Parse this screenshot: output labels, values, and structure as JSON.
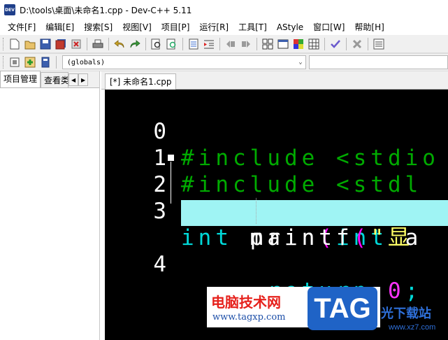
{
  "window": {
    "title": "D:\\tools\\桌面\\未命名1.cpp - Dev-C++ 5.11",
    "app_icon_text": "DEV"
  },
  "menu": [
    "文件[F]",
    "编辑[E]",
    "搜索[S]",
    "视图[V]",
    "项目[P]",
    "运行[R]",
    "工具[T]",
    "AStyle",
    "窗口[W]",
    "帮助[H]"
  ],
  "toolbar2": {
    "scope_combo": "(globals)"
  },
  "left_panel": {
    "tabs": [
      "项目管理",
      "查看类"
    ]
  },
  "editor": {
    "file_tab": "[*] 未命名1.cpp",
    "lines": [
      {
        "num": "0",
        "tokens": [
          {
            "t": "#include <stdio",
            "c": "pre"
          }
        ]
      },
      {
        "num": "1",
        "tokens": [
          {
            "t": "#include <stdl",
            "c": "pre"
          }
        ]
      },
      {
        "num": "2",
        "tokens": [
          {
            "t": "int",
            "c": "kw"
          },
          {
            "t": " main",
            "c": "id"
          },
          {
            "t": "(",
            "c": "paren"
          },
          {
            "t": "int",
            "c": "kw"
          },
          {
            "t": " a",
            "c": "id"
          }
        ]
      },
      {
        "num": "3",
        "tokens": [
          {
            "t": "    printf",
            "c": "id"
          },
          {
            "t": "(",
            "c": "paren"
          },
          {
            "t": "\"显 ",
            "c": "str"
          }
        ]
      },
      {
        "num": "4",
        "tokens": [
          {
            "t": "     return",
            "c": "kw"
          },
          {
            "t": " 0",
            "c": "num"
          },
          {
            "t": ";",
            "c": "kw"
          }
        ]
      }
    ]
  },
  "watermark": {
    "site_name": "电脑技术网",
    "site_url": "www.tagxp.com",
    "logo_text": "TAG",
    "xz_text": "光下载站",
    "xz_url": "www.xz7.com"
  }
}
